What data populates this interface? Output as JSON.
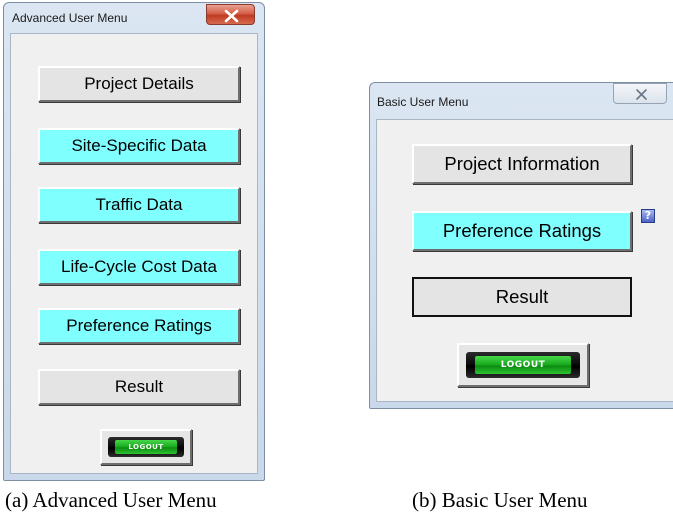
{
  "advanced_window": {
    "title": "Advanced User Menu",
    "buttons": [
      {
        "label": "Project Details",
        "color": "#e4e4e4"
      },
      {
        "label": "Site-Specific Data",
        "color": "#80ffff"
      },
      {
        "label": "Traffic Data",
        "color": "#80ffff"
      },
      {
        "label": "Life-Cycle Cost Data",
        "color": "#80ffff"
      },
      {
        "label": "Preference Ratings",
        "color": "#80ffff"
      },
      {
        "label": "Result",
        "color": "#e4e4e4"
      }
    ],
    "logout_label": "LOGOUT",
    "close_icon": "close-x-icon"
  },
  "basic_window": {
    "title": "Basic User Menu",
    "buttons": [
      {
        "label": "Project Information",
        "color": "#e4e4e4"
      },
      {
        "label": "Preference Ratings",
        "color": "#80ffff"
      },
      {
        "label": "Result",
        "color": "#e4e4e4"
      }
    ],
    "help_icon_label": "?",
    "logout_label": "LOGOUT",
    "close_icon": "close-x-icon"
  },
  "captions": {
    "a": "(a) Advanced User Menu",
    "b": "(b) Basic User Menu"
  },
  "colors": {
    "cyan_button": "#80ffff",
    "gray_button": "#e4e4e4",
    "logout_green": "#17a81c",
    "close_red": "#c03a22"
  }
}
